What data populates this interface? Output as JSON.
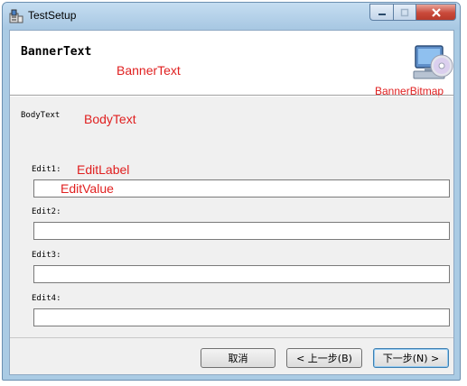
{
  "window": {
    "title": "TestSetup"
  },
  "banner": {
    "title": "BannerText",
    "title_annotation": "BannerText",
    "bitmap_annotation": "BannerBitmap",
    "bitmap_icon": "computer-cd-icon"
  },
  "body": {
    "text": "BodyText",
    "annotation": "BodyText"
  },
  "edits": [
    {
      "label": "Edit1:",
      "label_annotation": "EditLabel",
      "value_annotation": "EditValue",
      "value": ""
    },
    {
      "label": "Edit2:",
      "value": ""
    },
    {
      "label": "Edit3:",
      "value": ""
    },
    {
      "label": "Edit4:",
      "value": ""
    }
  ],
  "buttons": {
    "cancel": "取消",
    "back": "< 上一步(B)",
    "next": "下一步(N) >"
  },
  "colors": {
    "annotation": "#e02020",
    "title_bar": "#aacbe4",
    "close_button": "#c9493a",
    "dialog_face": "#f0f0f0"
  }
}
